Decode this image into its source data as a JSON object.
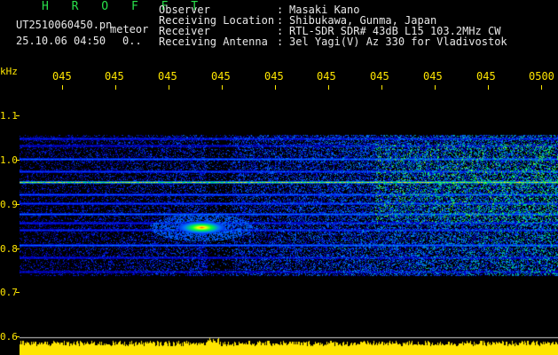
{
  "header": {
    "program": "H R O F F T",
    "filename": "UT2510060450.pn",
    "mode": "meteor",
    "datetime": "25.10.06 04:50",
    "counter": "0..",
    "labels": [
      "Observer",
      "Receiving Location",
      "Receiver",
      "Receiving Antenna"
    ],
    "separator": ":",
    "values": [
      "Masaki Kano",
      "Shibukawa, Gunma, Japan",
      "RTL-SDR SDR# 43dB L15 103.2MHz CW",
      "3el Yagi(V) Az 330 for Vladivostok"
    ]
  },
  "axes": {
    "y_unit": "kHz",
    "y_ticks": [
      "1.1",
      "1.0",
      "0.9",
      "0.8",
      "0.7",
      "0.6"
    ],
    "x_ticks": [
      "045",
      "045",
      "045",
      "045",
      "045",
      "045",
      "045",
      "045",
      "045",
      "0500"
    ]
  },
  "colors": {
    "accent_green": "#29e04a",
    "axis_yellow": "#ffe600",
    "background": "#000000",
    "noise_floor": "#0a1a9a",
    "signal_red": "#ff2a10"
  }
}
